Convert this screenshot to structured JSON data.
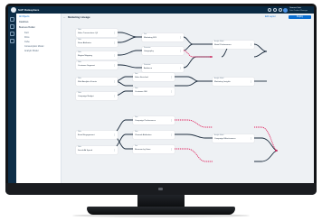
{
  "header": {
    "app_title": "SAP Datasphere",
    "icons": [
      "search-icon",
      "bell-icon",
      "help-icon"
    ],
    "user_name": "Gemma Soto",
    "user_role": "Data Product Manager"
  },
  "sidebar": {
    "items": [
      {
        "label": "All Objects",
        "sub": false,
        "active": true
      },
      {
        "label": "Dataflows",
        "sub": false,
        "active": false
      },
      {
        "label": "Business Builder",
        "sub": false,
        "active": false
      },
      {
        "label": "Fact",
        "sub": true,
        "active": false
      },
      {
        "label": "Dims",
        "sub": true,
        "active": false
      },
      {
        "label": "Cube",
        "sub": true,
        "active": false
      },
      {
        "label": "Consumption Model",
        "sub": true,
        "active": false
      },
      {
        "label": "Analytic Model",
        "sub": true,
        "active": false
      }
    ]
  },
  "main": {
    "title": "Marketing Lineage",
    "back_icon": "arrow-left-icon",
    "secondary_action": "Edit Layout",
    "primary_action": "Deploy"
  },
  "nodes": [
    {
      "type": "Table",
      "name": "Sales Transactions Q4"
    },
    {
      "type": "Table",
      "name": "Store Attributes"
    },
    {
      "type": "Table",
      "name": "Region Mapping"
    },
    {
      "type": "Table",
      "name": "Customer Segment"
    },
    {
      "type": "Table",
      "name": "Web Analytics Events"
    },
    {
      "type": "Table",
      "name": "Campaign Budget"
    },
    {
      "type": "Table",
      "name": "Email Engagement"
    },
    {
      "type": "Table",
      "name": "Social Ad Spend"
    },
    {
      "type": "View",
      "name": "Sales Enriched"
    },
    {
      "type": "View",
      "name": "Customer 360"
    },
    {
      "type": "View",
      "name": "Campaign Performance"
    },
    {
      "type": "View",
      "name": "Channel Attribution"
    },
    {
      "type": "Fact",
      "name": "Revenue by Store"
    },
    {
      "type": "Fact",
      "name": "Marketing ROI"
    },
    {
      "type": "Dimension",
      "name": "Geography"
    },
    {
      "type": "Dimension",
      "name": "Audience"
    },
    {
      "type": "Analytic Model",
      "name": "Retail Performance"
    },
    {
      "type": "Analytic Model",
      "name": "Marketing Insights"
    },
    {
      "type": "Analytic Model",
      "name": "Campaign Effectiveness"
    }
  ],
  "edge_colors": {
    "default": "#1d2d3e",
    "highlight": "#e0245e"
  }
}
